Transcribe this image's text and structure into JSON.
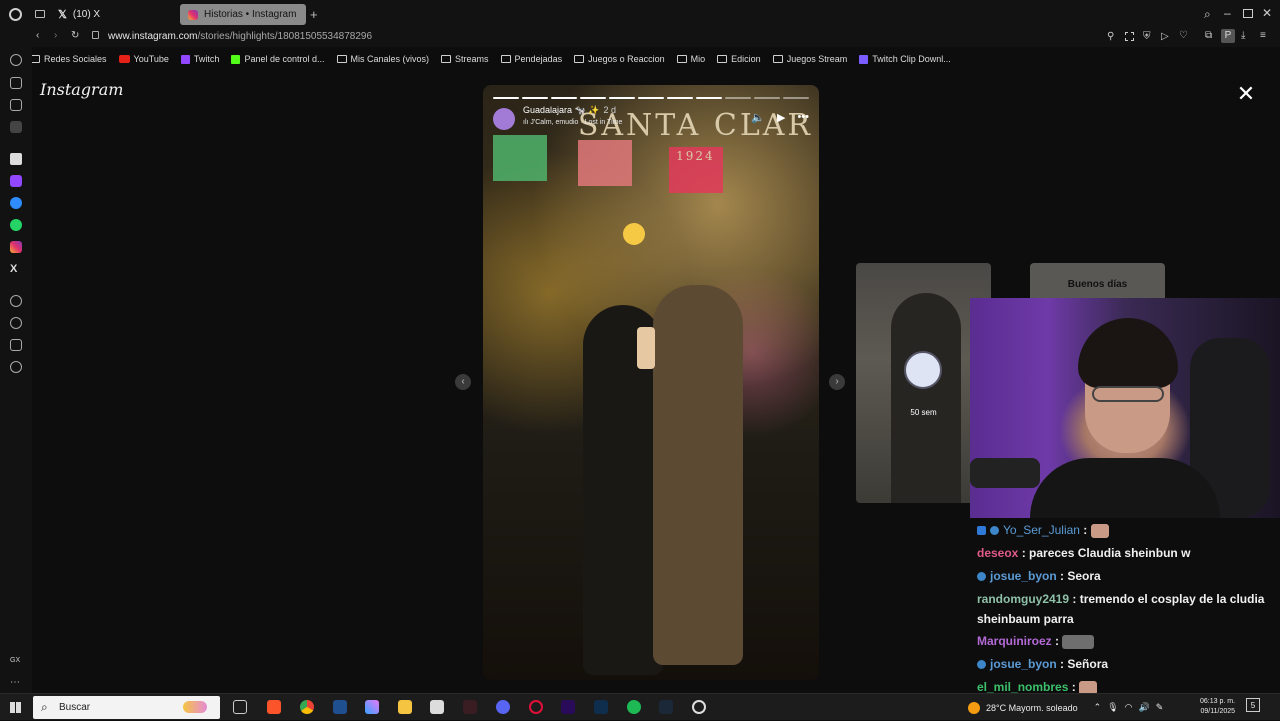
{
  "browser": {
    "tabs": [
      {
        "label": "(10) X",
        "icon": "x-icon"
      },
      {
        "label": "Historias • Instagram",
        "icon": "instagram-icon"
      }
    ],
    "new_tab": "+",
    "url_host": "www.instagram.com",
    "url_path": "/stories/highlights/18081505534878296",
    "profile_letter": "P"
  },
  "bookmarks": [
    {
      "label": "Redes Sociales"
    },
    {
      "label": "YouTube"
    },
    {
      "label": "Twitch"
    },
    {
      "label": "Panel de control d..."
    },
    {
      "label": "Mis Canales (vivos)"
    },
    {
      "label": "Streams"
    },
    {
      "label": "Pendejadas"
    },
    {
      "label": "Juegos o Reaccion"
    },
    {
      "label": "Mio"
    },
    {
      "label": "Edicion"
    },
    {
      "label": "Juegos Stream"
    },
    {
      "label": "Twitch Clip Downl..."
    }
  ],
  "instagram": {
    "logo": "Instagram",
    "close": "✕",
    "story": {
      "username": "Guadalajara 🐄 ✨",
      "time": "2 d",
      "music": "J'Calm, emudio · Lost in Time",
      "sign_text": "SANTA CLAR",
      "sign_year": "1924",
      "progress_total": 11,
      "progress_done": 8
    },
    "side_cards": [
      {
        "label": "",
        "badge": "50 sem"
      },
      {
        "label": "Buenos días",
        "badge": ""
      }
    ]
  },
  "chat": [
    {
      "user": "Yo_Ser_Julian",
      "color": "#5b9bd5",
      "text": "",
      "emote": true
    },
    {
      "user": "deseox",
      "color": "#e05a8a",
      "text": "pareces Claudia sheinbun w"
    },
    {
      "user": "josue_byon",
      "color": "#5b9bd5",
      "text": "Seora"
    },
    {
      "user": "randomguy2419",
      "color": "#8fc0a9",
      "text": "tremendo el cosplay de la cludia sheinbaum parra"
    },
    {
      "user": "Marquiniroez",
      "color": "#b36ad6",
      "text": "",
      "emote": true
    },
    {
      "user": "josue_byon",
      "color": "#5b9bd5",
      "text": "Señora"
    },
    {
      "user": "el_mil_nombres",
      "color": "#3bbf6a",
      "text": "",
      "emote": true
    }
  ],
  "taskbar": {
    "search_label": "Buscar",
    "weather": "28°C  Mayorm. soleado",
    "time": "06:13 p. m.",
    "date": "09/11/2025",
    "notif_count": "5"
  },
  "colors": {
    "instagram_gradient": [
      "#f9b233",
      "#e1306c",
      "#833ab4"
    ],
    "twitch_purple": "#9146ff"
  }
}
